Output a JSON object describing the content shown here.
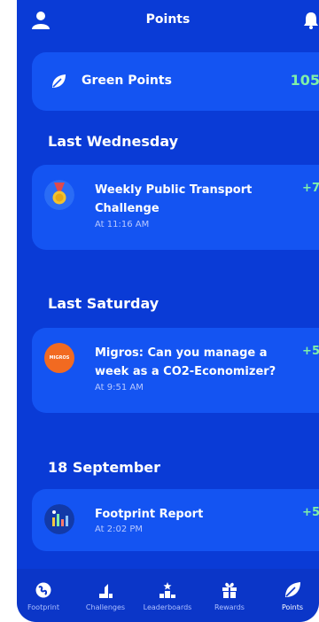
{
  "header": {
    "title": "Points",
    "left_icon": "user-icon",
    "right_icon": "bell-icon"
  },
  "green_points": {
    "label": "Green Points",
    "value": "105",
    "icon": "leaf-icon"
  },
  "sections": [
    {
      "title": "Last Wednesday",
      "entry": {
        "title": "Weekly Public Transport Challenge",
        "time": "At 11:16 AM",
        "points": "+7",
        "icon": "medal-icon"
      }
    },
    {
      "title": "Last Saturday",
      "entry": {
        "title": "Migros: Can you manage a week as a CO2-Economizer?",
        "time": "At 9:51 AM",
        "points": "+5",
        "icon": "migros-logo",
        "logo_text": "MIGROS"
      }
    },
    {
      "title": "18 September",
      "entry": {
        "title": "Footprint Report",
        "time": "At 2:02 PM",
        "points": "+5",
        "icon": "footprint-report-icon"
      }
    }
  ],
  "tabbar": [
    {
      "label": "Footprint",
      "icon": "globe-icon",
      "active": false
    },
    {
      "label": "Challenges",
      "icon": "challenges-icon",
      "active": false
    },
    {
      "label": "Leaderboards",
      "icon": "podium-icon",
      "active": false
    },
    {
      "label": "Rewards",
      "icon": "gift-icon",
      "active": false
    },
    {
      "label": "Points",
      "icon": "leaf-icon",
      "active": true
    }
  ],
  "colors": {
    "background": "#0a3bd6",
    "card": "#1454f2",
    "points_green": "#7ff0a8",
    "muted_text": "#b9c9ff",
    "migros_orange": "#f26a21"
  }
}
